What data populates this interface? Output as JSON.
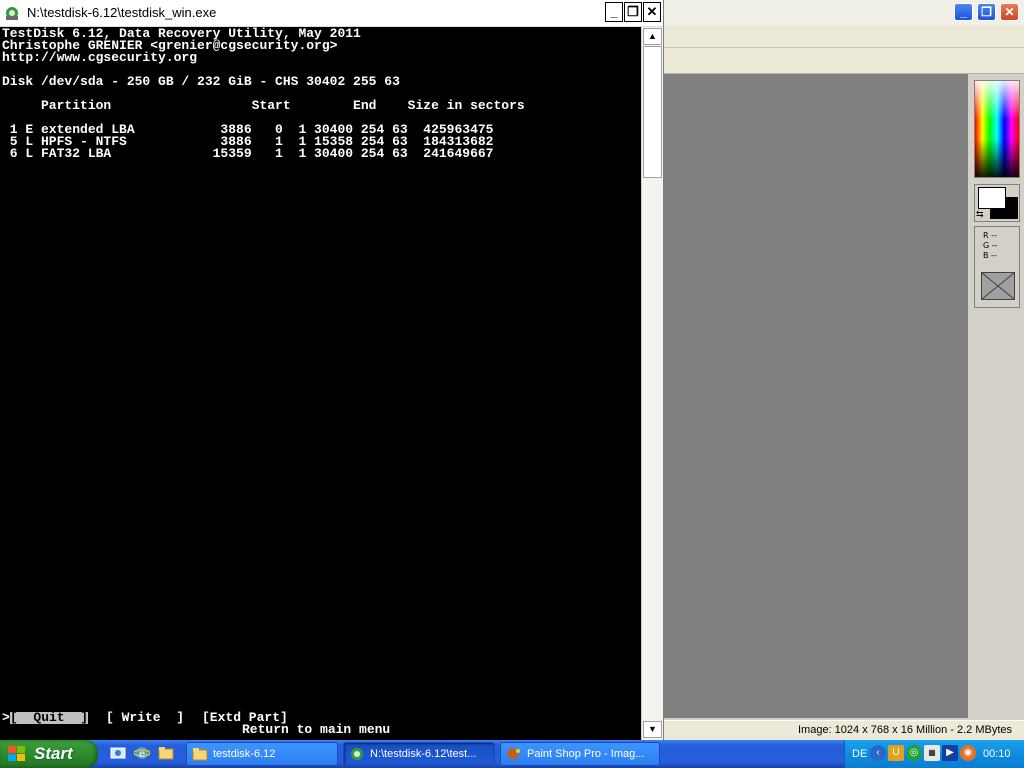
{
  "console": {
    "title": "N:\\testdisk-6.12\\testdisk_win.exe",
    "window_buttons": {
      "minimize": "_",
      "restore": "❐",
      "close": "✕"
    },
    "lines": {
      "header1": "TestDisk 6.12, Data Recovery Utility, May 2011",
      "header2": "Christophe GRENIER <grenier@cgsecurity.org>",
      "header3": "http://www.cgsecurity.org",
      "disk": "Disk /dev/sda - 250 GB / 232 GiB - CHS 30402 255 63",
      "columns": "     Partition                  Start        End    Size in sectors"
    },
    "partitions": [
      " 1 E extended LBA           3886   0  1 30400 254 63  425963475",
      " 5 L HPFS - NTFS            3886   1  1 15358 254 63  184313682",
      " 6 L FAT32 LBA             15359   1  1 30400 254 63  241649667"
    ],
    "menu": {
      "cursor": ">",
      "quit": "[  Quit  ]",
      "write": "[ Write  ]",
      "extd": "[Extd Part]"
    },
    "hint": "Return to main menu",
    "scroll_up": "▲",
    "scroll_down": "▼"
  },
  "paintshop": {
    "window_buttons": {
      "minimize": "_",
      "restore": "❐",
      "close": "✕"
    },
    "rgb": {
      "r": "R --",
      "g": "G --",
      "b": "B --"
    },
    "status": "Image:  1024 x 768 x 16 Million - 2.2 MBytes"
  },
  "taskbar": {
    "start_label": "Start",
    "quick_launch": [
      "desktop-icon",
      "ie-icon",
      "explorer-icon"
    ],
    "tasks": [
      {
        "label": "testdisk-6.12",
        "icon": "folder-icon"
      },
      {
        "label": "N:\\testdisk-6.12\\test...",
        "icon": "console-icon"
      },
      {
        "label": "Paint Shop Pro - Imag...",
        "icon": "paintshop-icon"
      }
    ],
    "tray": {
      "lang": "DE",
      "clock": "00:10"
    }
  }
}
